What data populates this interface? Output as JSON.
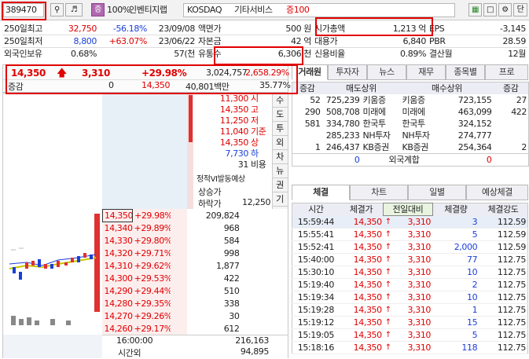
{
  "toolbar": {
    "code": "389470",
    "stock_name": "인벤티지랩",
    "pct_label": "100%",
    "market": "KOSDAQ",
    "sector": "기타서비스",
    "margin": "증100",
    "unit_label": "단",
    "eq_icon": "equals-icon",
    "chat_icon": "chat-icon",
    "gear_icon": "gear-icon",
    "window_icon": "window-icon"
  },
  "info": {
    "rows": [
      {
        "label": "250일최고",
        "value": "32,750",
        "pct": "-56.18%",
        "date": "23/09/08",
        "label2": "액면가",
        "value2": "500 원",
        "label3": "시가총액",
        "value3": "1,213 억",
        "label4": "EPS",
        "value4": "-3,145"
      },
      {
        "label": "250일최저",
        "value": "8,800",
        "pct": "+63.07%",
        "date": "23/06/22",
        "label2": "자본금",
        "value2": "42 억",
        "label3": "대용가",
        "value3": "6,840",
        "label4": "PBR",
        "value4": "28.59"
      },
      {
        "label": "외국인보유",
        "value": "0.68%",
        "pct": "",
        "date": "57(천",
        "label2": "유통수",
        "value2": "6,306 천",
        "label3": "신용비율",
        "value3": "0.89%",
        "label4": "결산월",
        "value4": "12월"
      }
    ]
  },
  "quote": {
    "price": "14,350",
    "change": "3,310",
    "rate": "+29.98%",
    "volume": "3,024,757",
    "amount": "2,658.29%",
    "up_icon": "up-arrow-icon",
    "row2_label": "증감",
    "row2_val": "0",
    "row2_price": "14,350",
    "row2_value": "40,801백만",
    "row2_pct": "35.77%"
  },
  "orderbook": {
    "sell_prices": [
      {
        "price": "11,300",
        "label": "시"
      },
      {
        "price": "14,350",
        "label": "고"
      },
      {
        "price": "11,250",
        "label": "저"
      },
      {
        "price": "11,040",
        "label": "기준"
      },
      {
        "price": "14,350",
        "label": "상"
      },
      {
        "price": "7,730",
        "label": "하"
      },
      {
        "price": "31",
        "label": "비용"
      }
    ],
    "side_tabs": [
      "수",
      "도",
      "투",
      "외",
      "차",
      "뉴",
      "권",
      "기"
    ],
    "vi_label": "정적VI발동예상",
    "vi_up": "상승가",
    "vi_down": "하락가",
    "vi_down_val": "12,250",
    "buy_rows": [
      {
        "price": "14,350",
        "pct": "+29.98%",
        "qty": "209,824"
      },
      {
        "price": "14,340",
        "pct": "+29.89%",
        "qty": "968"
      },
      {
        "price": "14,330",
        "pct": "+29.80%",
        "qty": "584"
      },
      {
        "price": "14,320",
        "pct": "+29.71%",
        "qty": "998"
      },
      {
        "price": "14,310",
        "pct": "+29.62%",
        "qty": "1,877"
      },
      {
        "price": "14,300",
        "pct": "+29.53%",
        "qty": "422"
      },
      {
        "price": "14,290",
        "pct": "+29.44%",
        "qty": "510"
      },
      {
        "price": "14,280",
        "pct": "+29.35%",
        "qty": "338"
      },
      {
        "price": "14,270",
        "pct": "+29.26%",
        "qty": "30"
      },
      {
        "price": "14,260",
        "pct": "+29.17%",
        "qty": "612"
      }
    ],
    "foot_time": "16:00:00",
    "foot_qty1": "216,163",
    "foot_label": "시간외",
    "foot_qty2": "94,895"
  },
  "broker": {
    "tabs": [
      "거래원",
      "투자자",
      "뉴스",
      "재무",
      "종목별",
      "프로"
    ],
    "head": [
      "증감",
      "매도상위",
      "매수상위",
      "증감"
    ],
    "rows": [
      {
        "d1": "52",
        "sell_qty": "725,239",
        "sell_name": "키움증",
        "buy_name": "키움증",
        "buy_qty": "723,155",
        "d2": "27"
      },
      {
        "d1": "290",
        "sell_qty": "508,708",
        "sell_name": "미래에",
        "buy_name": "미래에",
        "buy_qty": "463,099",
        "d2": "422"
      },
      {
        "d1": "581",
        "sell_qty": "334,780",
        "sell_name": "한국투",
        "buy_name": "한국투",
        "buy_qty": "324,152",
        "d2": ""
      },
      {
        "d1": "",
        "sell_qty": "285,233",
        "sell_name": "NH투자",
        "buy_name": "NH투자",
        "buy_qty": "274,777",
        "d2": ""
      },
      {
        "d1": "1",
        "sell_qty": "246,437",
        "sell_name": "KB증권",
        "buy_name": "KB증권",
        "buy_qty": "254,364",
        "d2": "2"
      }
    ],
    "foreign": {
      "left": "0",
      "label": "외국계합",
      "right": "0"
    }
  },
  "trades": {
    "tabs": [
      "체결",
      "차트",
      "일별",
      "예상체결"
    ],
    "head": [
      "시간",
      "체결가",
      "전일대비",
      "체결량",
      "체결강도"
    ],
    "rows": [
      {
        "time": "15:59:44",
        "price": "14,350",
        "diff": "3,310",
        "qty": "3",
        "str": "112.59"
      },
      {
        "time": "15:55:41",
        "price": "14,350",
        "diff": "3,310",
        "qty": "5",
        "str": "112.59"
      },
      {
        "time": "15:52:41",
        "price": "14,350",
        "diff": "3,310",
        "qty": "2,000",
        "str": "112.59"
      },
      {
        "time": "15:40:00",
        "price": "14,350",
        "diff": "3,310",
        "qty": "77",
        "str": "112.75"
      },
      {
        "time": "15:30:10",
        "price": "14,350",
        "diff": "3,310",
        "qty": "10",
        "str": "112.75"
      },
      {
        "time": "15:19:40",
        "price": "14,350",
        "diff": "3,310",
        "qty": "2",
        "str": "112.75"
      },
      {
        "time": "15:19:34",
        "price": "14,350",
        "diff": "3,310",
        "qty": "10",
        "str": "112.75"
      },
      {
        "time": "15:19:28",
        "price": "14,350",
        "diff": "3,310",
        "qty": "1",
        "str": "112.75"
      },
      {
        "time": "15:19:12",
        "price": "14,350",
        "diff": "3,310",
        "qty": "15",
        "str": "112.75"
      },
      {
        "time": "15:19:05",
        "price": "14,350",
        "diff": "3,310",
        "qty": "5",
        "str": "112.75"
      },
      {
        "time": "15:18:16",
        "price": "14,350",
        "diff": "3,310",
        "qty": "118",
        "str": "112.75"
      }
    ]
  }
}
